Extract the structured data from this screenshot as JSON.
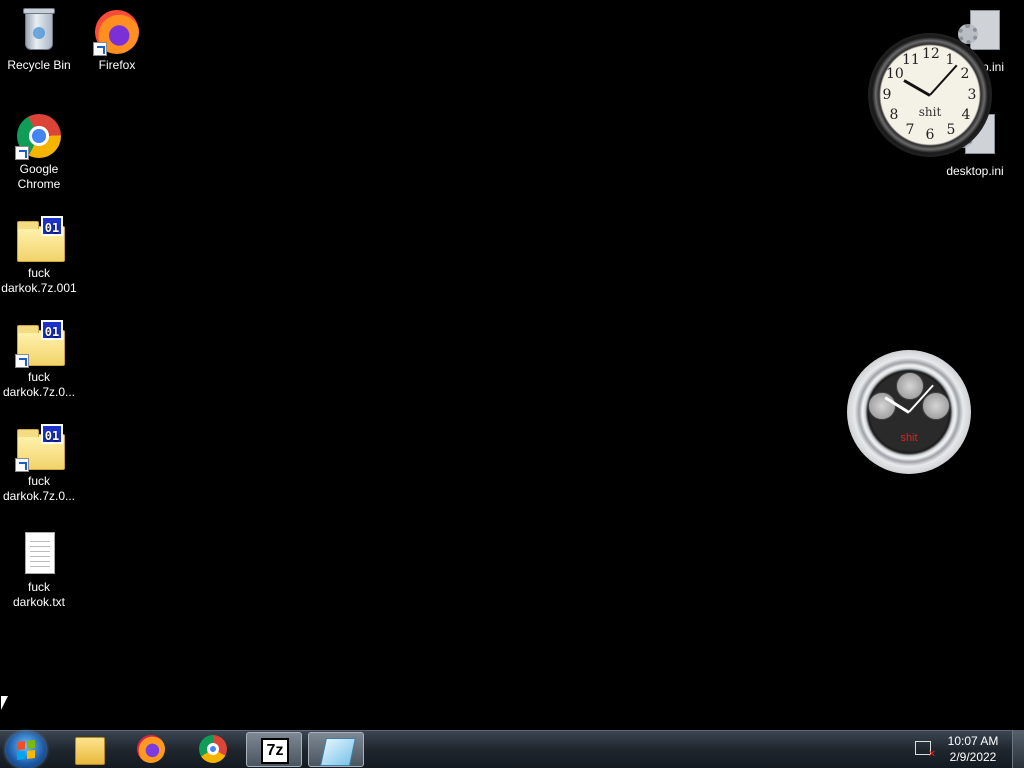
{
  "desktop": {
    "icons": [
      {
        "label": "Recycle Bin",
        "icon": "recycle-bin-icon"
      },
      {
        "label": "Firefox",
        "icon": "firefox-icon",
        "shortcut": true
      },
      {
        "label": "Google Chrome",
        "icon": "chrome-icon",
        "shortcut": true
      },
      {
        "label": "fuck darkok.7z.001",
        "icon": "archive-icon",
        "tag": "01"
      },
      {
        "label": "fuck darkok.7z.0...",
        "icon": "archive-icon",
        "tag": "01",
        "shortcut": true
      },
      {
        "label": "fuck darkok.7z.0...",
        "icon": "archive-icon",
        "tag": "01",
        "shortcut": true
      },
      {
        "label": "fuck darkok.txt",
        "icon": "text-file-icon"
      },
      {
        "label": "p.ini",
        "icon": "settings-file-icon"
      },
      {
        "label": "desktop.ini",
        "icon": "settings-file-icon"
      }
    ]
  },
  "gadgets": {
    "analog_clock": {
      "brand": "shit",
      "numbers": [
        "12",
        "1",
        "2",
        "3",
        "4",
        "5",
        "6",
        "7",
        "8",
        "9",
        "10",
        "11"
      ]
    },
    "chrono_clock": {
      "brand": "shit"
    }
  },
  "taskbar": {
    "start_icon": "windows-start-icon",
    "pinned": [
      {
        "name": "windows-explorer",
        "icon": "folder-icon"
      },
      {
        "name": "firefox",
        "icon": "firefox-icon"
      },
      {
        "name": "google-chrome",
        "icon": "chrome-icon"
      },
      {
        "name": "7-zip",
        "icon": "sevenzip-icon",
        "glyph": "7z",
        "active": true
      },
      {
        "name": "notepad",
        "icon": "notepad-icon",
        "active": true
      }
    ],
    "tray": {
      "network_icon": "network-disconnected-icon",
      "time": "10:07 AM",
      "date": "2/9/2022"
    }
  }
}
